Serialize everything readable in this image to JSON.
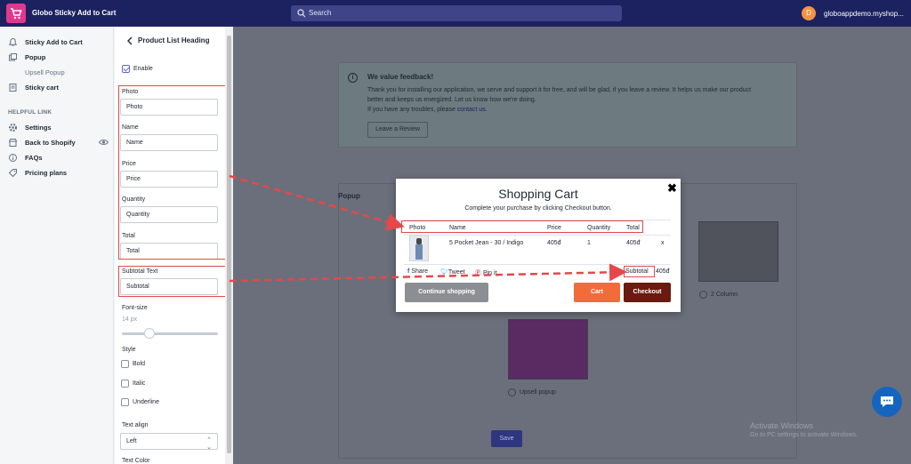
{
  "topbar": {
    "app_title": "Globo Sticky Add to Cart",
    "search_placeholder": "Search",
    "avatar_letter": "D",
    "store_name": "globoappdemo.myshop..."
  },
  "nav": {
    "items": [
      {
        "label": "Sticky Add to Cart",
        "icon": "bell-icon"
      },
      {
        "label": "Popup",
        "icon": "popup-icon"
      },
      {
        "label": "Upsell Popup",
        "icon": ""
      },
      {
        "label": "Sticky cart",
        "icon": "document-icon"
      }
    ],
    "helpful_heading": "HELPFUL LINK",
    "helpful": [
      {
        "label": "Settings",
        "icon": "gear-icon"
      },
      {
        "label": "Back to Shopify",
        "icon": "store-icon"
      },
      {
        "label": "FAQs",
        "icon": "info-icon"
      },
      {
        "label": "Pricing plans",
        "icon": "tag-icon"
      }
    ]
  },
  "panel": {
    "title": "Product List Heading",
    "enable_label": "Enable",
    "fields": [
      {
        "label": "Photo",
        "value": "Photo"
      },
      {
        "label": "Name",
        "value": "Name"
      },
      {
        "label": "Price",
        "value": "Price"
      },
      {
        "label": "Quantity",
        "value": "Quantity"
      },
      {
        "label": "Total",
        "value": "Total"
      }
    ],
    "subtotal_label": "Subtotal Text",
    "subtotal_value": "Subtotal",
    "font_size_label": "Font-size",
    "font_size_value": "14 px",
    "style_label": "Style",
    "style_options": [
      "Bold",
      "Italic",
      "Underline"
    ],
    "text_align_label": "Text align",
    "text_align_value": "Left",
    "text_color_label": "Text Color"
  },
  "feedback": {
    "title": "We value feedback!",
    "line1": "Thank you for installing our application, we serve and support it for free, and will be glad, if you leave a review. It helps us make our product",
    "line2": "better and keeps us energized. Let us know how we're doing.",
    "line3_prefix": "If you have any troubles, please ",
    "line3_link": "contact us",
    "line3_suffix": ".",
    "review_button": "Leave a Review"
  },
  "popup": {
    "label": "Popup",
    "option_2col": "2 Column",
    "option_upsell": "Upsell popup",
    "save": "Save"
  },
  "modal": {
    "title": "Shopping Cart",
    "subtitle": "Complete your purchase by clicking Checkout button.",
    "headers": {
      "photo": "Photo",
      "name": "Name",
      "price": "Price",
      "quantity": "Quantity",
      "total": "Total"
    },
    "row": {
      "name": "5 Pocket Jean - 30 / Indigo",
      "price": "405đ",
      "quantity": "1",
      "total": "405đ",
      "remove": "x"
    },
    "share": "Share",
    "tweet": "Tweet",
    "pinit": "Pin it",
    "subtotal_label": "Subtotal",
    "subtotal_value": "405đ",
    "continue_button": "Continue shopping",
    "cart_button": "Cart",
    "checkout_button": "Checkout"
  },
  "windows": {
    "activate_title": "Activate Windows",
    "activate_sub": "Go to PC settings to activate Windows."
  },
  "colors": {
    "topbar": "#1c2260",
    "annotation_red": "#e54848",
    "cart_orange": "#f26b3a",
    "checkout_brown": "#6b1a0f"
  }
}
